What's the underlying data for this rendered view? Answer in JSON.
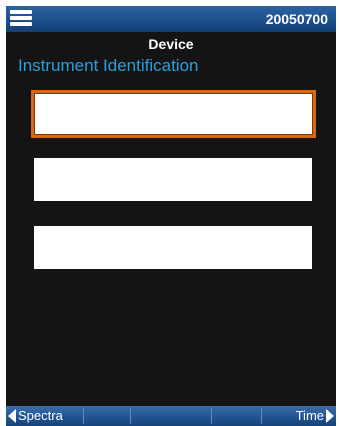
{
  "header": {
    "serial_number": "20050700",
    "menu_icon": "hamburger-menu-icon"
  },
  "page": {
    "title": "Device",
    "section_title": "Instrument Identification"
  },
  "fields": [
    {
      "value": "",
      "placeholder": "",
      "focused": true
    },
    {
      "value": "",
      "placeholder": ""
    },
    {
      "value": "",
      "placeholder": ""
    }
  ],
  "footer": {
    "prev_label": "Spectra",
    "next_label": "Time",
    "prev_icon": "arrow-left-icon",
    "next_icon": "arrow-right-icon"
  },
  "colors": {
    "bar_blue": "#1c4f8c",
    "accent_cyan": "#2a9fe0",
    "focus_orange": "#d9670f",
    "background": "#141414"
  }
}
